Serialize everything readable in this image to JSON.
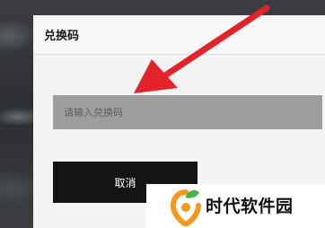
{
  "dialog": {
    "title": "兑换码",
    "input_placeholder": "请输入兑换码",
    "cancel_label": "取消"
  },
  "watermark": {
    "text": "时代软件园"
  },
  "colors": {
    "arrow": "#e2232a",
    "input_bg": "#9e9e9e",
    "button_bg": "#141414",
    "logo_orange": "#f39a1e",
    "logo_green": "#45b549"
  },
  "icons": [
    "annotation-arrow",
    "site-logo-icon"
  ]
}
